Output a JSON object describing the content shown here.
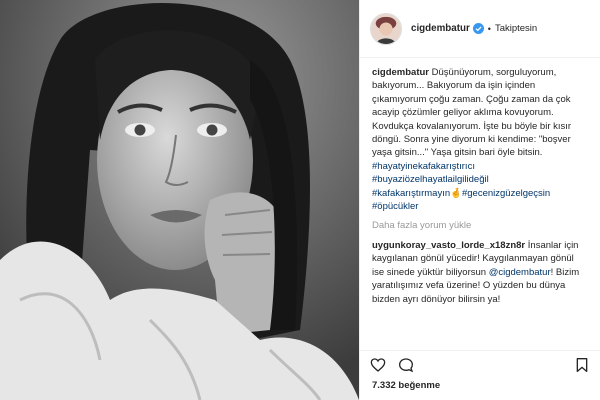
{
  "post": {
    "username": "cigdembatur",
    "follow_status": "Takiptesin",
    "separator": "•",
    "caption": {
      "author": "cigdembatur",
      "text": "Düşünüyorum, sorguluyorum, bakıyorum... Bakıyorum da işin içinden çıkamıyorum çoğu zaman. Çoğu zaman da çok acayip çözümler geliyor aklıma kovuyorum. Kovdukça kovalanıyorum. İşte bu böyle bir kısır döngü. Sonra yine diyorum ki kendime: \"boşver yaşa gitsin...\" Yaşa gitsin bari öyle bitsin.",
      "hashtags": [
        "#hayatyinekafakarıştırıcı",
        "#buyaziözelhayatlailgilideğil",
        "#kafakarıştırmayın",
        "#gecenizgüzelgeçsin",
        "#öpücükler"
      ],
      "hashtag_inline_emoji": "🤞"
    },
    "load_more": "Daha fazla yorum yükle",
    "comment": {
      "author": "uygunkoray_vasto_lorde_x18zn8r",
      "text_1": "İnsanlar için kaygılanan gönül yücedir! Kaygılanmayan gönül ise sinede yüktür biliyorsun",
      "mention": "@cigdembatur",
      "text_2": "! Bizim yaratılışımız vefa üzerine! O yüzden bu dünya bizden ayrı dönüyor bilirsin ya!"
    },
    "likes": "7.332 beğenme",
    "icons": [
      "heart-icon",
      "comment-icon",
      "save-icon",
      "verified-badge-icon"
    ],
    "colors": {
      "hashtag": "#003569",
      "verified": "#3897f0",
      "muted": "#999999",
      "border": "#efefef"
    }
  }
}
